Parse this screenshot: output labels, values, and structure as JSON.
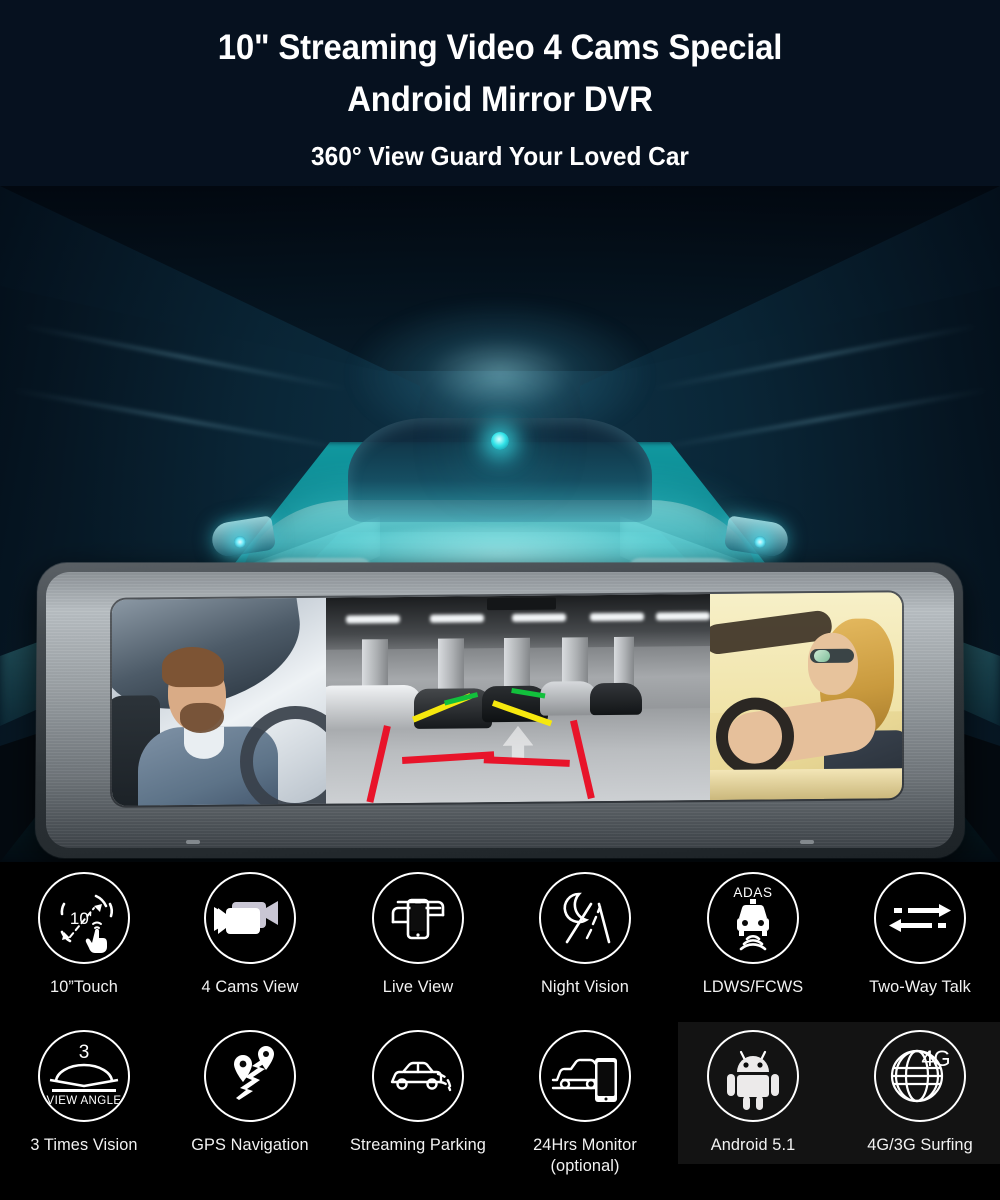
{
  "header": {
    "title_line_1": "10\" Streaming Video 4 Cams Special",
    "title_line_2": "Android Mirror DVR",
    "subtitle": "360° View Guard Your Loved Car"
  },
  "colors": {
    "background_dark_navy": "#06111f",
    "feature_panel_black": "#000000",
    "glow_cyan": "#2fe3e8",
    "text_white": "#ffffff",
    "guide_red": "#e8142a",
    "guide_yellow": "#f6e80e",
    "guide_green": "#12c03c"
  },
  "hero": {
    "alt": "teal glowing sports car in tunnel with 360 degree camera light cones and rear-view mirror mount"
  },
  "device": {
    "alt": "10 inch streaming rear view mirror dash cam showing three camera panes",
    "panes": [
      {
        "name": "driver-cabin-view",
        "caption": "man driving"
      },
      {
        "name": "rear-parking-view",
        "caption": "underground parking garage with parking guide lines"
      },
      {
        "name": "front-cabin-view",
        "caption": "woman driving convertible"
      }
    ]
  },
  "features": {
    "row_1": [
      {
        "icon": "ten-inch-touch-icon",
        "label": "10”Touch",
        "badge": "10'"
      },
      {
        "icon": "video-camera-icon",
        "label": "4 Cams View"
      },
      {
        "icon": "live-view-phone-icon",
        "label": "Live View"
      },
      {
        "icon": "night-vision-moon-road-icon",
        "label": "Night Vision"
      },
      {
        "icon": "adas-car-icon",
        "label": "LDWS/FCWS",
        "badge": "ADAS"
      },
      {
        "icon": "two-way-arrows-icon",
        "label": "Two-Way Talk"
      }
    ],
    "row_2": [
      {
        "icon": "view-angle-icon",
        "label": "3 Times Vision",
        "badge": "3",
        "badge_2": "VIEW ANGLE"
      },
      {
        "icon": "gps-route-pins-icon",
        "label": "GPS Navigation"
      },
      {
        "icon": "streaming-parking-car-icon",
        "label": "Streaming Parking"
      },
      {
        "icon": "24hrs-monitor-icon",
        "label": "24Hrs Monitor\n(optional)"
      },
      {
        "icon": "android-robot-icon",
        "label": "Android 5.1"
      },
      {
        "icon": "globe-4g-icon",
        "label": "4G/3G Surfing",
        "badge": "4G"
      }
    ]
  }
}
